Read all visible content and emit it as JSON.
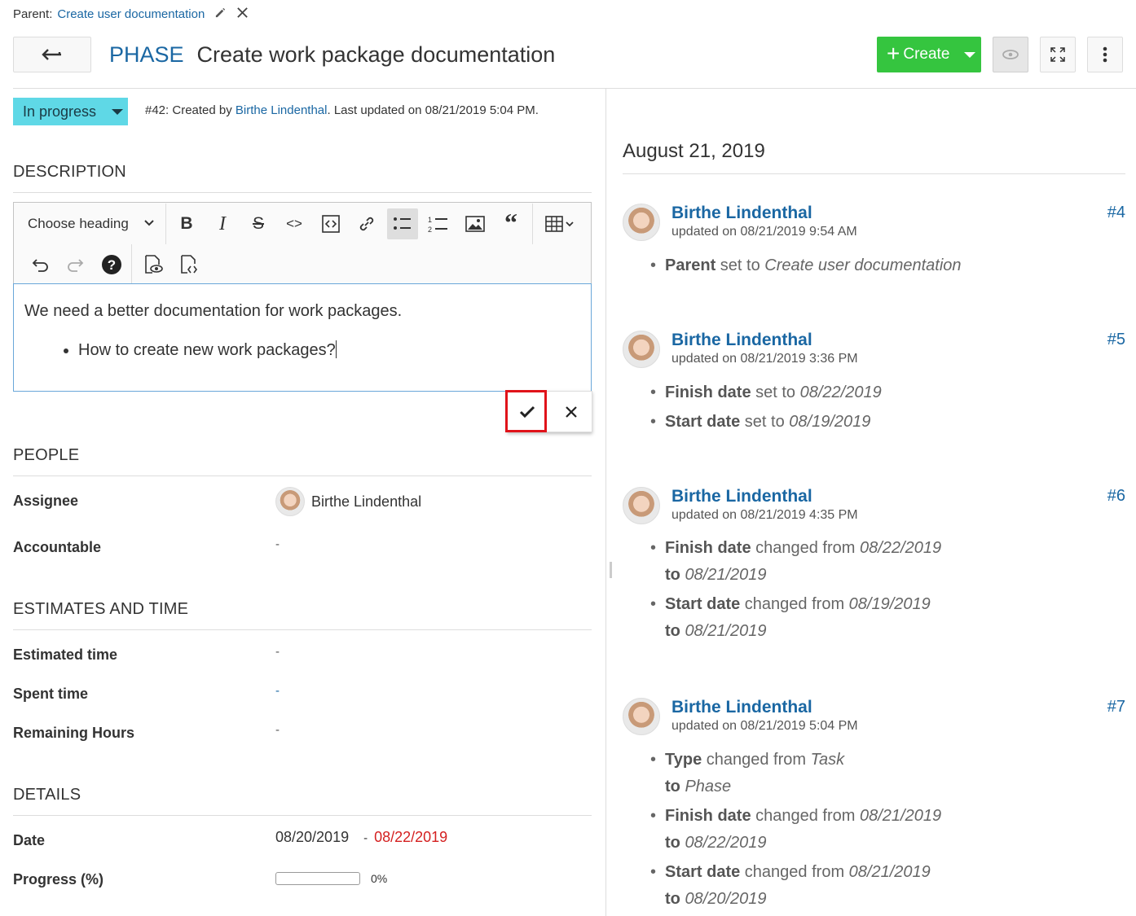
{
  "header": {
    "parent_label": "Parent:",
    "parent_link": "Create user documentation",
    "type": "PHASE",
    "subject": "Create work package documentation",
    "create_label": "Create"
  },
  "status": {
    "label": "In progress",
    "meta_prefix": "#42: Created by ",
    "meta_author": "Birthe Lindenthal",
    "meta_suffix": ". Last updated on 08/21/2019 5:04 PM."
  },
  "sections": {
    "description": "DESCRIPTION",
    "people": "PEOPLE",
    "estimates": "ESTIMATES AND TIME",
    "details": "DETAILS"
  },
  "editor": {
    "heading_select": "Choose heading",
    "paragraph": "We need a better documentation for work packages.",
    "bullet": "How to create new work packages?"
  },
  "people": {
    "assignee_label": "Assignee",
    "assignee_value": "Birthe Lindenthal",
    "accountable_label": "Accountable",
    "accountable_value": "-"
  },
  "estimates": {
    "estimated_label": "Estimated time",
    "estimated_value": "-",
    "spent_label": "Spent time",
    "spent_value": "-",
    "remaining_label": "Remaining Hours",
    "remaining_value": "-"
  },
  "details": {
    "date_label": "Date",
    "date_start": "08/20/2019",
    "date_sep": "-",
    "date_end": "08/22/2019",
    "progress_label": "Progress (%)",
    "progress_value": "0%",
    "progress_fraction": 0
  },
  "activity": {
    "date": "August 21, 2019",
    "entries": [
      {
        "user": "Birthe Lindenthal",
        "num": "#4",
        "when": "updated on 08/21/2019 9:54 AM",
        "changes": [
          {
            "field": "Parent",
            "text": " set to ",
            "value": "Create user documentation"
          }
        ]
      },
      {
        "user": "Birthe Lindenthal",
        "num": "#5",
        "when": "updated on 08/21/2019 3:36 PM",
        "changes": [
          {
            "field": "Finish date",
            "text": " set to ",
            "value": "08/22/2019"
          },
          {
            "field": "Start date",
            "text": " set to ",
            "value": "08/19/2019"
          }
        ]
      },
      {
        "user": "Birthe Lindenthal",
        "num": "#6",
        "when": "updated on 08/21/2019 4:35 PM",
        "changes": [
          {
            "field": "Finish date",
            "text": " changed from ",
            "value": "08/22/2019",
            "to_text": "to ",
            "to_value": "08/21/2019"
          },
          {
            "field": "Start date",
            "text": " changed from ",
            "value": "08/19/2019",
            "to_text": "to ",
            "to_value": "08/21/2019"
          }
        ]
      },
      {
        "user": "Birthe Lindenthal",
        "num": "#7",
        "when": "updated on 08/21/2019 5:04 PM",
        "changes": [
          {
            "field": "Type",
            "text": " changed from ",
            "value": "Task",
            "to_text": "to ",
            "to_value": "Phase"
          },
          {
            "field": "Finish date",
            "text": " changed from ",
            "value": "08/21/2019",
            "to_text": "to ",
            "to_value": "08/22/2019"
          },
          {
            "field": "Start date",
            "text": " changed from ",
            "value": "08/21/2019",
            "to_text": "to ",
            "to_value": "08/20/2019"
          }
        ]
      }
    ]
  },
  "colors": {
    "link": "#1a67a3",
    "create": "#35c53f",
    "status": "#5fd8e6",
    "overdue": "#d42020",
    "highlight": "#e0131a"
  }
}
